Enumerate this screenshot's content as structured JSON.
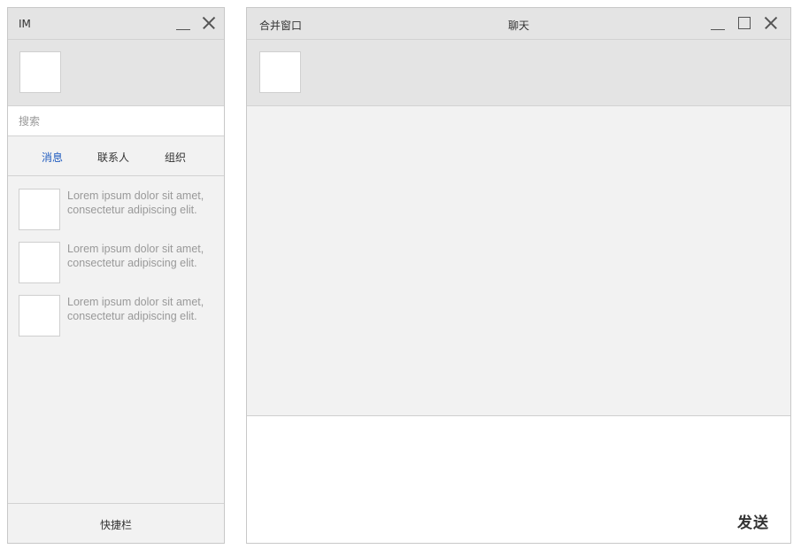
{
  "im_window": {
    "title": "IM",
    "search": {
      "placeholder": "搜索",
      "value": ""
    },
    "tabs": [
      {
        "label": "消息",
        "active": true
      },
      {
        "label": "联系人",
        "active": false
      },
      {
        "label": "组织",
        "active": false
      }
    ],
    "messages": [
      {
        "preview": "Lorem ipsum dolor sit amet, consectetur adipiscing elit."
      },
      {
        "preview": "Lorem ipsum dolor sit amet, consectetur adipiscing elit."
      },
      {
        "preview": "Lorem ipsum dolor sit amet, consectetur adipiscing elit."
      }
    ],
    "quickbar_label": "快捷栏"
  },
  "chat_window": {
    "merge_label": "合并窗口",
    "title": "聊天",
    "send_label": "发送"
  },
  "icons": {
    "minimize": "minimize-icon",
    "maximize": "maximize-icon",
    "close": "close-icon"
  },
  "colors": {
    "active_tab": "#1f5bbf",
    "titlebar_bg": "#e4e4e4",
    "panel_bg": "#f2f2f2"
  }
}
